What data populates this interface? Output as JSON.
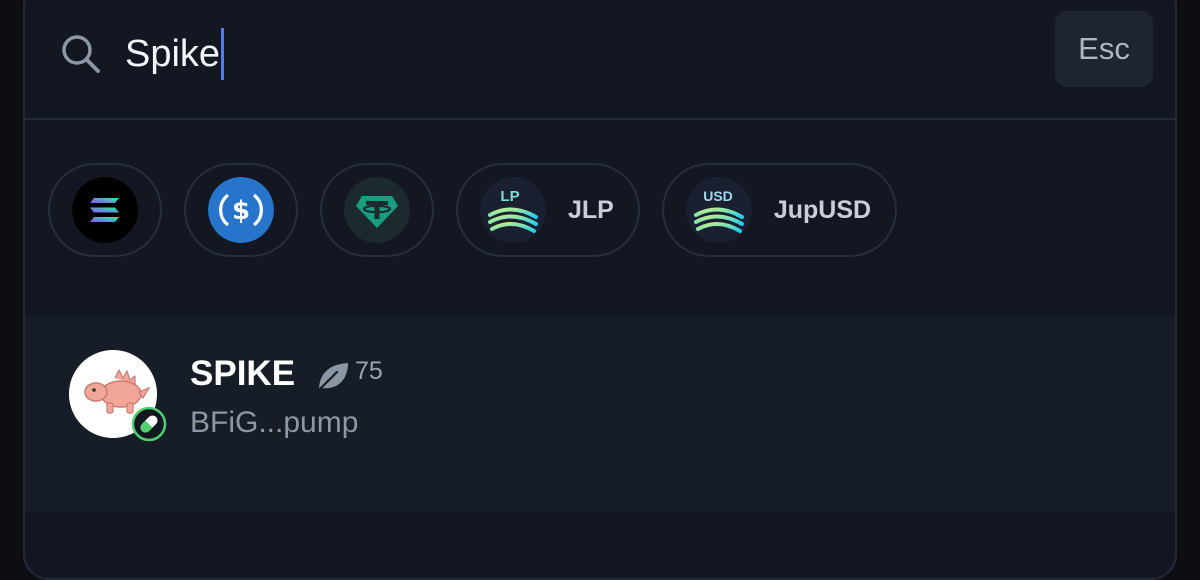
{
  "search": {
    "query": "Spike",
    "esc_label": "Esc"
  },
  "quick_tokens": [
    {
      "icon": "solana-icon",
      "label": ""
    },
    {
      "icon": "usdc-icon",
      "label": ""
    },
    {
      "icon": "tether-icon",
      "label": ""
    },
    {
      "icon": "jlp-icon",
      "icon_text": "LP",
      "label": "JLP"
    },
    {
      "icon": "jupusd-icon",
      "icon_text": "USD",
      "label": "JupUSD"
    }
  ],
  "results": [
    {
      "name": "SPIKE",
      "score": "75",
      "address": "BFiG...pump",
      "icons": [
        "spike-avatar",
        "pill-badge-icon",
        "leaf-icon"
      ]
    }
  ],
  "colors": {
    "background": "#0c0e12",
    "panel": "#121722",
    "result_row": "#171d27",
    "caret": "#4f7df0",
    "usdc": "#2775ca",
    "tether": "#1a9c7f",
    "verified": "#4fcf70"
  }
}
